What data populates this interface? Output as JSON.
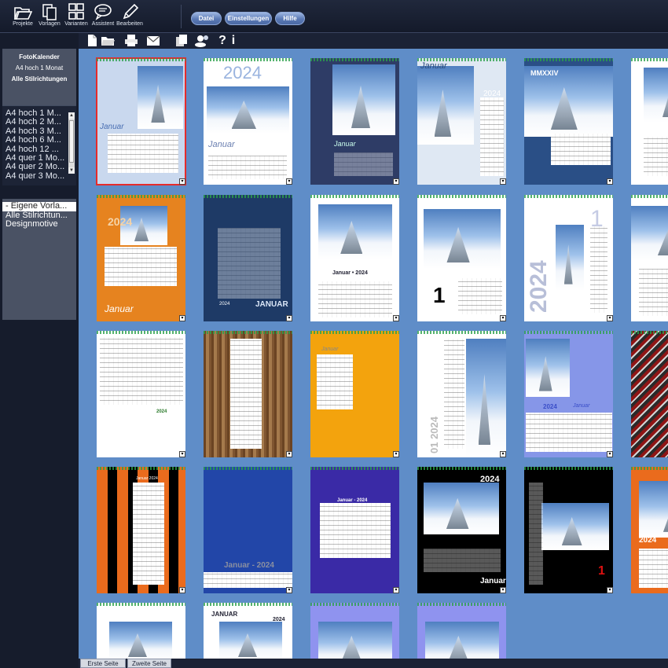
{
  "toolbar": {
    "tools": [
      {
        "label": "Projekte",
        "icon": "folder-open-icon"
      },
      {
        "label": "Vorlagen",
        "icon": "templates-icon"
      },
      {
        "label": "Varianten",
        "icon": "grid-icon"
      },
      {
        "label": "Assistent",
        "icon": "speech-bubble-icon"
      },
      {
        "label": "Bearbeiten",
        "icon": "pencil-icon"
      }
    ],
    "menu": [
      {
        "label": "Datei"
      },
      {
        "label": "Einstellungen"
      },
      {
        "label": "Hilfe"
      }
    ]
  },
  "subbar": {
    "icons": [
      "new-document-icon",
      "open-folder-icon",
      "print-icon",
      "email-icon",
      "copy-icon",
      "users-icon",
      "help-question-icon",
      "info-icon"
    ],
    "labels": [
      "?",
      "i"
    ]
  },
  "left": {
    "category": {
      "title": "FotoKalender",
      "format": "A4 hoch 1 Monat",
      "style": "Alle Stilrichtungen"
    },
    "formats": [
      "A4 hoch 1 M...",
      "A4 hoch 2 M...",
      "A4 hoch 3 M...",
      "A4 hoch 6 M...",
      "A4 hoch 12 ...",
      "A4 quer 1 Mo...",
      "A4 quer 2 Mo...",
      "A4 quer 3 Mo..."
    ],
    "styles": [
      "- Eigene Vorla...",
      "Alle Stilrichtun...",
      "Designmotive"
    ]
  },
  "cards": [
    {
      "texts": [
        "Januar"
      ]
    },
    {
      "texts": [
        "2024",
        "Januar"
      ]
    },
    {
      "texts": [
        "Januar"
      ]
    },
    {
      "texts": [
        "Januar",
        "2024"
      ]
    },
    {
      "texts": [
        "MMXXIV"
      ]
    },
    {
      "texts": []
    },
    {
      "texts": [
        "2024",
        "Januar"
      ]
    },
    {
      "texts": [
        "2024",
        "JANUAR"
      ]
    },
    {
      "texts": [
        "Januar • 2024"
      ]
    },
    {
      "texts": [
        "1"
      ]
    },
    {
      "texts": [
        "2024",
        "1"
      ]
    },
    {
      "texts": []
    },
    {
      "texts": [
        "2024"
      ]
    },
    {
      "texts": []
    },
    {
      "texts": [
        "Januar"
      ]
    },
    {
      "texts": [
        "01 2024"
      ]
    },
    {
      "texts": [
        "2024",
        "Januar"
      ]
    },
    {
      "texts": []
    },
    {
      "texts": [
        "Januar 2024"
      ]
    },
    {
      "texts": [
        "Januar - 2024"
      ]
    },
    {
      "texts": [
        "Januar - 2024"
      ]
    },
    {
      "texts": [
        "2024",
        "Januar"
      ]
    },
    {
      "texts": [
        "1"
      ]
    },
    {
      "texts": [
        "2024"
      ]
    },
    {
      "texts": []
    },
    {
      "texts": [
        "JANUAR",
        "2024"
      ]
    },
    {
      "texts": []
    },
    {
      "texts": []
    }
  ],
  "tabs": [
    {
      "label": "Erste Seite"
    },
    {
      "label": "Zweite Seite"
    }
  ]
}
